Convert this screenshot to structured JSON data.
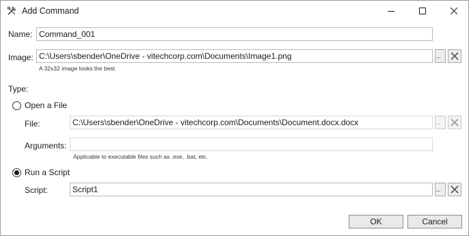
{
  "window": {
    "title": "Add Command",
    "controls": {
      "minimize_icon": "minimize-icon",
      "maximize_icon": "maximize-icon",
      "close_icon": "close-icon"
    }
  },
  "name": {
    "label": "Name:",
    "value": "Command_001"
  },
  "image": {
    "label": "Image:",
    "value": "C:\\Users\\sbender\\OneDrive - vitechcorp.com\\Documents\\Image1.png",
    "hint": "A 32x32 image looks the best",
    "browse_label": "..."
  },
  "type": {
    "label": "Type:",
    "open_file": {
      "label": "Open a File",
      "selected": false,
      "file_label": "File:",
      "file_value": "C:\\Users\\sbender\\OneDrive - vitechcorp.com\\Documents\\Document.docx.docx",
      "browse_label": "...",
      "arguments_label": "Arguments:",
      "arguments_value": "",
      "arguments_hint": "Applicable to executable files such as .exe, .bat, etc."
    },
    "run_script": {
      "label": "Run a Script",
      "selected": true,
      "script_label": "Script:",
      "script_value": "Script1",
      "browse_label": "..."
    }
  },
  "buttons": {
    "ok": "OK",
    "cancel": "Cancel"
  },
  "colors": {
    "border": "#b8b8b8",
    "button_bg": "#e9e9e9",
    "text": "#1a1a1a"
  }
}
